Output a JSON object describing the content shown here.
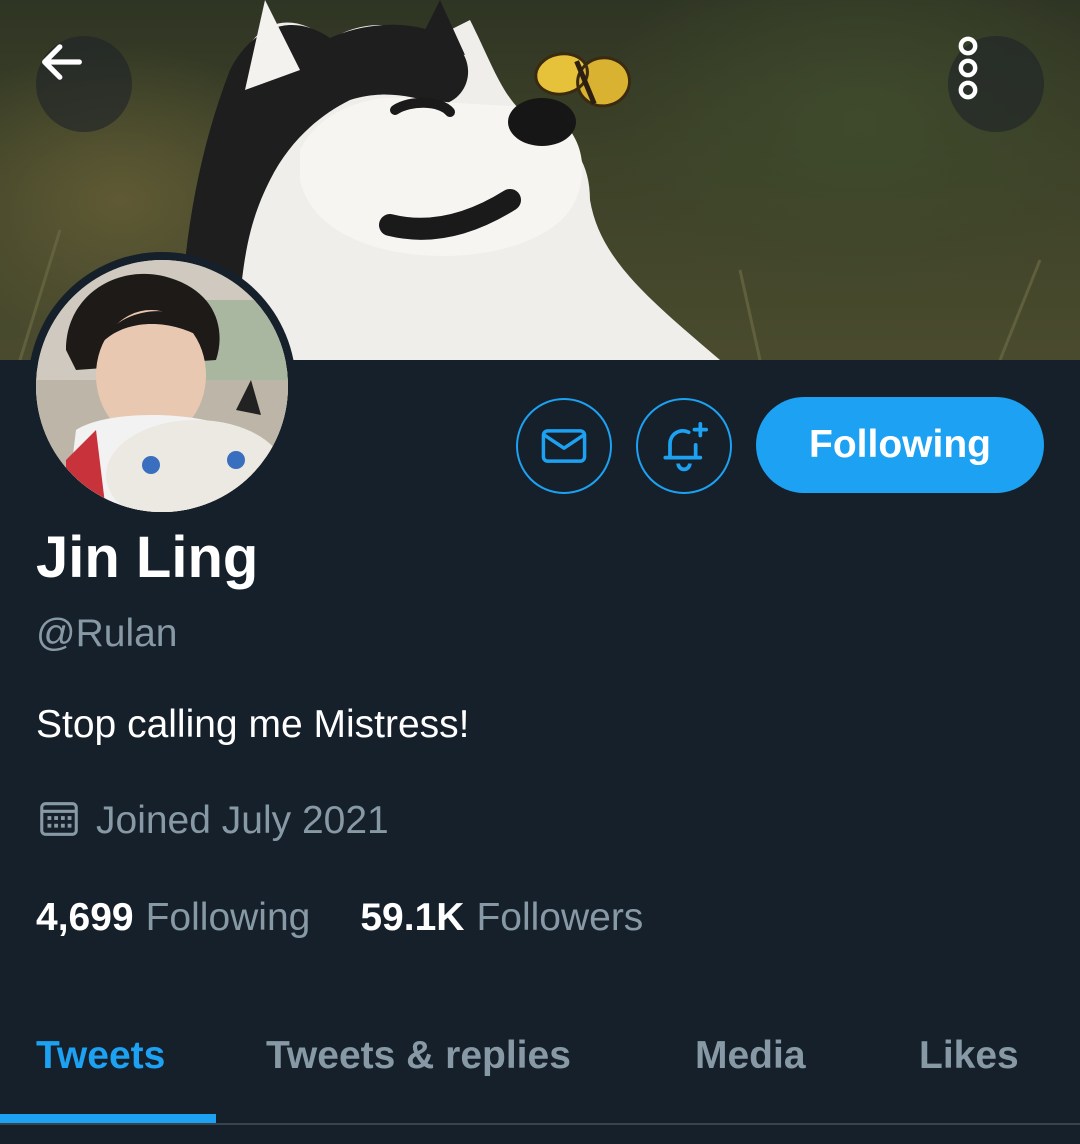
{
  "profile": {
    "display_name": "Jin Ling",
    "handle": "@Rulan",
    "bio": "Stop calling me Mistress!",
    "joined": "Joined July 2021"
  },
  "stats": {
    "following_count": "4,699",
    "following_label": "Following",
    "followers_count": "59.1K",
    "followers_label": "Followers"
  },
  "actions": {
    "follow_label": "Following"
  },
  "tabs": [
    {
      "label": "Tweets",
      "active": true
    },
    {
      "label": "Tweets & replies",
      "active": false
    },
    {
      "label": "Media",
      "active": false
    },
    {
      "label": "Likes",
      "active": false
    }
  ],
  "icons": {
    "back": "arrow-left-icon",
    "more": "more-vertical-icon",
    "message": "envelope-icon",
    "notify": "bell-plus-icon",
    "calendar": "calendar-icon"
  },
  "colors": {
    "background": "#15202b",
    "accent": "#1da1f2",
    "secondary_text": "#8899a6",
    "primary_text": "#ffffff"
  }
}
